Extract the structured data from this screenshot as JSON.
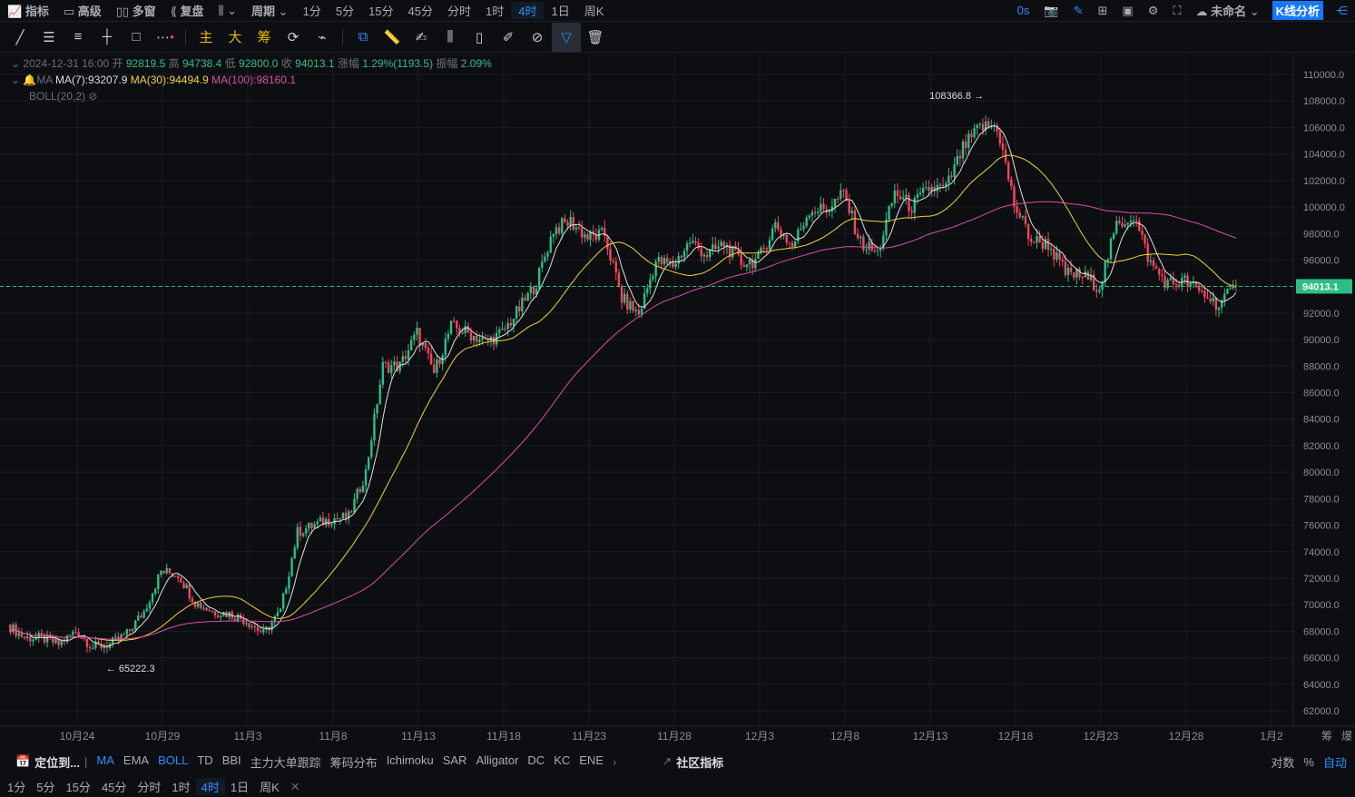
{
  "top": {
    "items": [
      "指标",
      "高级",
      "多窗",
      "复盘"
    ],
    "period_label": "周期",
    "periods": [
      "1分",
      "5分",
      "15分",
      "45分",
      "分时",
      "1时",
      "4时",
      "1日",
      "周K"
    ],
    "active_period": "4时",
    "timer": "0s",
    "layout_name": "未命名",
    "kline_button": "K线分析"
  },
  "toolbar": {
    "main": "主",
    "big": "大",
    "chip": "筹"
  },
  "legend": {
    "datetime": "2024-12-31 16:00",
    "open_label": "开",
    "open": "92819.5",
    "high_label": "高",
    "high": "94738.4",
    "low_label": "低",
    "low": "92800.0",
    "close_label": "收",
    "close": "94013.1",
    "change_label": "涨幅",
    "change": "1.29%(1193.5)",
    "amp_label": "振幅",
    "amp": "2.09%",
    "ma_label": "MA",
    "ma7": "MA(7):93207.9",
    "ma30": "MA(30):94494.9",
    "ma100": "MA(100):98160.1",
    "boll": "BOLL(20,2)"
  },
  "indicators": {
    "locate": "定位到...",
    "list": [
      "MA",
      "EMA",
      "BOLL",
      "TD",
      "BBI",
      "主力大单跟踪",
      "筹码分布",
      "Ichimoku",
      "SAR",
      "Alligator",
      "DC",
      "KC",
      "ENE"
    ],
    "active": [
      "MA",
      "BOLL"
    ],
    "community": "社区指标",
    "log": "对数",
    "pct": "%",
    "auto": "自动"
  },
  "bottom_periods": [
    "1分",
    "5分",
    "15分",
    "45分",
    "分时",
    "1时",
    "4时",
    "1日",
    "周K"
  ],
  "colors": {
    "up": "#2ebd85",
    "down": "#f6465d",
    "ma7": "#e0e0e0",
    "ma30": "#f0d43a",
    "ma100": "#d84fa8",
    "accent": "#2f8cff"
  },
  "chart_data": {
    "type": "candlestick",
    "interval": "4h",
    "start_day": "10月20",
    "daily_close": [
      68500,
      67500,
      67500,
      67000,
      68000,
      66800,
      67000,
      67800,
      69500,
      72500,
      72300,
      70200,
      69500,
      69300,
      68800,
      67800,
      69500,
      75500,
      76000,
      76500,
      76600,
      80000,
      88000,
      88000,
      90500,
      87500,
      91000,
      90500,
      89800,
      90500,
      92300,
      94300,
      98300,
      98900,
      97700,
      97900,
      93100,
      91900,
      95900,
      95600,
      97400,
      96400,
      97200,
      95800,
      96000,
      98700,
      97000,
      99800,
      99800,
      101000,
      97300,
      96500,
      101100,
      100000,
      101400,
      101400,
      104400,
      106000,
      106100,
      100200,
      97500,
      97200,
      95000,
      94800,
      94000,
      98600,
      99400,
      95700,
      94200,
      94400,
      93500,
      92600,
      94013.1
    ],
    "x_ticks": [
      "10月24",
      "10月29",
      "11月3",
      "11月8",
      "11月13",
      "11月18",
      "11月23",
      "11月28",
      "12月3",
      "12月8",
      "12月13",
      "12月18",
      "12月23",
      "12月28",
      "1月2"
    ],
    "y_ticks": [
      62000,
      64000,
      66000,
      68000,
      70000,
      72000,
      74000,
      76000,
      78000,
      80000,
      82000,
      84000,
      86000,
      88000,
      90000,
      92000,
      94000,
      96000,
      98000,
      100000,
      102000,
      104000,
      106000,
      108000,
      110000
    ],
    "ylim": [
      62000,
      110000
    ],
    "max_label": "108366.8",
    "min_label": "65222.3",
    "last_price": "94013.1",
    "series": [
      "MA(7)",
      "MA(30)",
      "MA(100)"
    ],
    "axis_corner": [
      "筹",
      "爆"
    ]
  }
}
